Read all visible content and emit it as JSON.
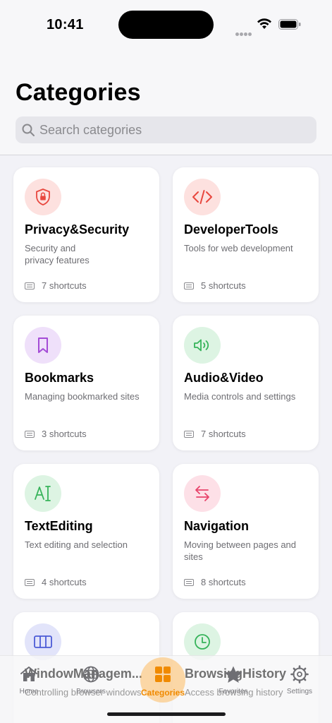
{
  "status": {
    "time": "10:41"
  },
  "header": {
    "title": "Categories"
  },
  "search": {
    "placeholder": "Search categories"
  },
  "categories": [
    {
      "title": "Privacy&Security",
      "description": "Security and privacy features",
      "shortcuts": "7 shortcuts",
      "icon": "lock-shield-icon",
      "color": "#e8473e",
      "bg": "#fde1df"
    },
    {
      "title": "DeveloperTools",
      "description": "Tools for web development",
      "shortcuts": "5 shortcuts",
      "icon": "code-icon",
      "color": "#e8473e",
      "bg": "#fde1df"
    },
    {
      "title": "Bookmarks",
      "description": "Managing bookmarked sites",
      "shortcuts": "3 shortcuts",
      "icon": "bookmark-icon",
      "color": "#a44bd6",
      "bg": "#efe0fa"
    },
    {
      "title": "Audio&Video",
      "description": "Media controls and settings",
      "shortcuts": "7 shortcuts",
      "icon": "speaker-icon",
      "color": "#36b35a",
      "bg": "#ddf4e3"
    },
    {
      "title": "TextEditing",
      "description": "Text editing and selection",
      "shortcuts": "4 shortcuts",
      "icon": "text-cursor-icon",
      "color": "#36b35a",
      "bg": "#ddf4e3"
    },
    {
      "title": "Navigation",
      "description": "Moving between pages and sites",
      "shortcuts": "8 shortcuts",
      "icon": "arrows-icon",
      "color": "#e8436b",
      "bg": "#fde0e7"
    },
    {
      "title": "WindowManagem...",
      "description": "Controlling browser windows",
      "shortcuts": "",
      "icon": "columns-icon",
      "color": "#4b5bd6",
      "bg": "#e2e4fa"
    },
    {
      "title": "BrowsingHistory",
      "description": "Access browsing history",
      "shortcuts": "",
      "icon": "clock-icon",
      "color": "#36b35a",
      "bg": "#ddf4e3"
    }
  ],
  "ghost": {
    "left_title": "WindowManagem...",
    "left_desc": "Controlling browser windows",
    "right_title": "BrowsingHistory",
    "right_desc": "Access browsing history"
  },
  "tabs": [
    {
      "label": "Home",
      "icon": "house-icon"
    },
    {
      "label": "Browsers",
      "icon": "globe-icon"
    },
    {
      "label": "Categories",
      "icon": "grid-icon",
      "active": true
    },
    {
      "label": "Favorites",
      "icon": "star-icon"
    },
    {
      "label": "Settings",
      "icon": "gear-icon"
    }
  ],
  "colors": {
    "accent": "#f08a00"
  }
}
